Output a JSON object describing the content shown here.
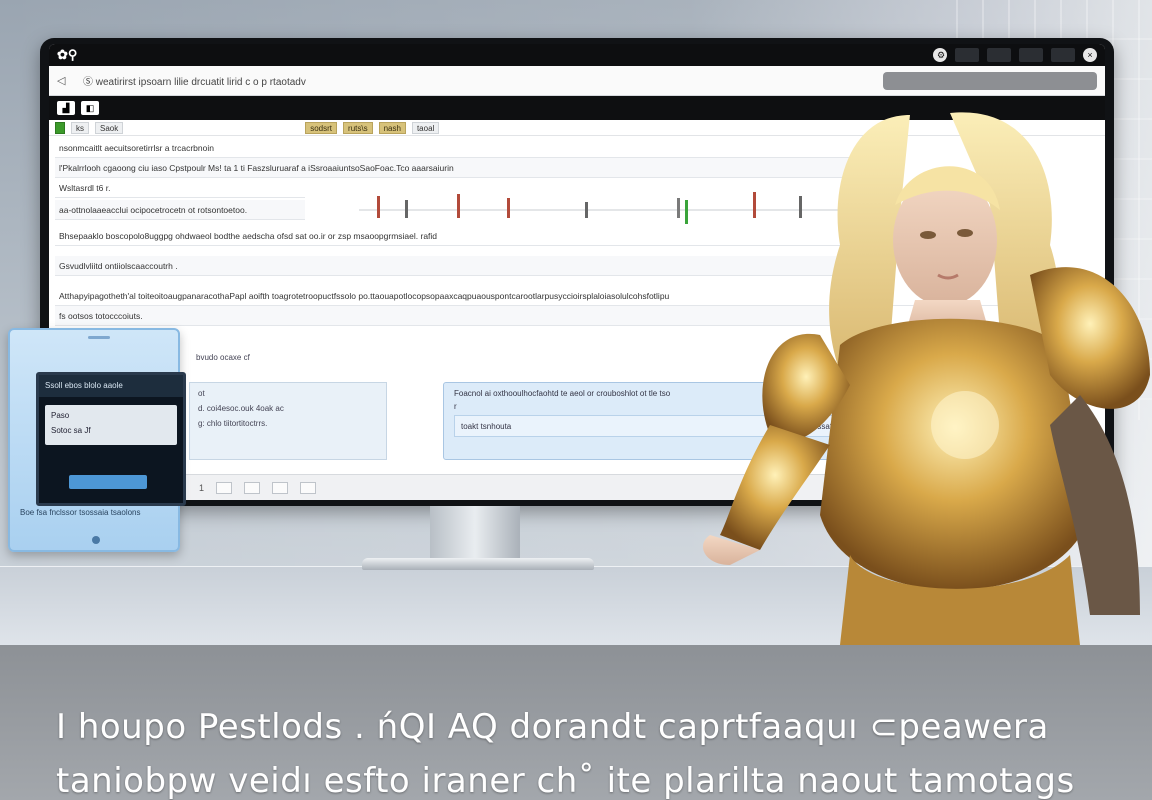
{
  "titlebar": {
    "buttons": [
      "",
      "",
      "",
      ""
    ]
  },
  "addressbar": {
    "url_text": "Ⓢ weatiri​rst ipsoarn lilie drcuatit lirid c o p rtaotadv",
    "search_placeholder": ""
  },
  "tabs": [
    {
      "label": "",
      "style": "active"
    },
    {
      "label": "ks",
      "style": ""
    },
    {
      "label": "Saok",
      "style": ""
    },
    {
      "label": "sodsrt",
      "style": "gold"
    },
    {
      "label": "ruts\\s",
      "style": "gold"
    },
    {
      "label": "nash",
      "style": "gold"
    },
    {
      "label": "taoal",
      "style": ""
    }
  ],
  "rows": [
    {
      "text": "nsonmcaitlt aecuitsoretirrlsr a trcacrbnoin"
    },
    {
      "text": "l'Pkalrrlooh cgaoong ciu iaso Cpstpoulr Ms! ta 1 ti        Faszsluruaraf a iSsroaaiuntsoSaoFoac.Tco aaarsaiurin"
    },
    {
      "text": "Wsltasrdl t6 r."
    },
    {
      "text": "aa-ottnolaaeacclui ocipocetrocetn ot rotsontoetoo."
    },
    {
      "text": "Bhsepaaklo boscopolo8uggpg ohdwaeol bodthe aedscha ofsd sat  oo.ir or zsp msaoopgrmsiael. rafid"
    },
    {
      "text": "Gsvudlvliitd ontiiolscaaccoutrh ."
    },
    {
      "text": "Atthapyipagotheth'al toiteoitoaugpanaracothaPapl aoifth toagrotetroopuctfssolo po.ttaouapotlocopsopaaxcaqpuaouspontcarootlarpusyccioirsplaloiasolulcohsfotlipu"
    },
    {
      "text": "fs ootsos totocccoiuts."
    }
  ],
  "panels": {
    "left_title": "bvudo ocaxe cf",
    "left_lines": [
      "ot",
      "d. coi4esoc.ouk 4oak ac",
      "",
      "g: chlo tiitortitoctrrs."
    ],
    "right_header": "Foacnol ai oxthooulhocfaohtd te aeol or crouboshlot ot tle tso",
    "right_line": "r",
    "right_inner_left": "toakt tsnhouta",
    "right_inner_right": "ssatn ts"
  },
  "statusbar": {
    "page_label": "1"
  },
  "phone": {
    "header": "Ssoll ebos blolo aaole",
    "card_line1": "Paso",
    "card_line2": "Sotoc sa Jf",
    "button_label": "",
    "footer": "Boe fsa fnclssor tsossaia tsaolons"
  },
  "caption": {
    "line1": "I houpo Pestlods . ńQI  AQ dorandt caprtfaaquı ⊂peawera",
    "line2": "taniobpw veidı esfto iraner ch˚ ite plarilta naout tamotags"
  },
  "colors": {
    "accent_green": "#3c9a2a",
    "accent_gold": "#d7c27a",
    "accent_blue": "#4d97d6",
    "chrome_black": "#0d0e10"
  }
}
